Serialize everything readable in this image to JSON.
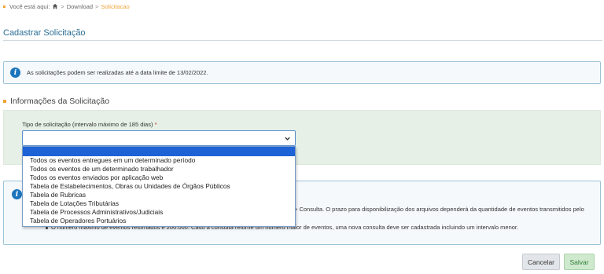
{
  "breadcrumb": {
    "prefix": "Você está aqui:",
    "items": [
      "Download",
      "Solicitacao"
    ],
    "separator": ">"
  },
  "page": {
    "title": "Cadastrar Solicitação"
  },
  "info": {
    "message": "As solicitações podem ser realizadas até a data limite de 13/02/2022."
  },
  "section": {
    "title": "Informações da Solicitação"
  },
  "form": {
    "request_type_label": "Tipo de solicitação (intervalo máximo de 185 dias)",
    "required_mark": "*",
    "request_type_value": ""
  },
  "dropdown": {
    "options": [
      "Todos os eventos entregues em um determinado período",
      "Todos os eventos de um determinado trabalhador",
      "Todos os eventos enviados por aplicação web",
      "Tabela de Estabelecimentos, Obras ou Unidades de Órgãos Públicos",
      "Tabela de Rubricas",
      "Tabela de Lotações Tributárias",
      "Tabela de Processos Administrativos/Judiciais",
      "Tabela de Operadores Portuários"
    ]
  },
  "notes": {
    "line1": "> Consulta. O prazo para disponibilização dos arquivos dependerá da quantidade de eventos transmitidos pelo",
    "line2": "O número máximo de eventos retornados é 200.000. Caso a consulta retorne um número maior de eventos, uma nova consulta deve ser cadastrada incluindo um intervalo menor."
  },
  "buttons": {
    "cancel": "Cancelar",
    "save": "Salvar"
  },
  "colors": {
    "accent": "#f0a43a",
    "link": "#2b6f94",
    "info_blue": "#1b75bc",
    "highlight": "#1e63d6"
  }
}
